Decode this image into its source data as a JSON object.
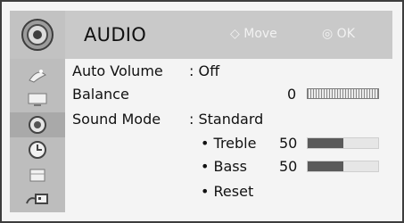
{
  "header": {
    "title": "AUDIO",
    "move_label": "Move",
    "ok_label": "OK"
  },
  "sidebar": {
    "items": [
      {
        "icon": "satellite-dish-icon",
        "active": false
      },
      {
        "icon": "monitor-icon",
        "active": false
      },
      {
        "icon": "audio-speaker-icon",
        "active": true
      },
      {
        "icon": "clock-icon",
        "active": false
      },
      {
        "icon": "lock-icon",
        "active": false
      },
      {
        "icon": "input-plug-icon",
        "active": false
      }
    ]
  },
  "menu": {
    "auto_volume": {
      "label": "Auto Volume",
      "value": ": Off"
    },
    "balance": {
      "label": "Balance",
      "value": "0"
    },
    "sound_mode": {
      "label": "Sound Mode",
      "value": ": Standard"
    },
    "treble": {
      "label": "• Treble",
      "value": "50",
      "level": 0.5
    },
    "bass": {
      "label": "• Bass",
      "value": "50",
      "level": 0.5
    },
    "reset": {
      "label": "• Reset"
    }
  }
}
